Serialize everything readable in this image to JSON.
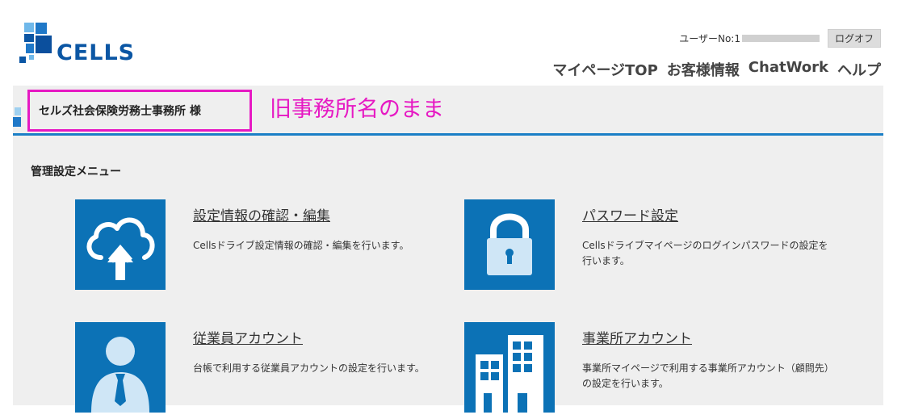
{
  "header": {
    "logo_text": "CELLS",
    "user_label": "ユーザーNo:",
    "user_no": "1",
    "logoff_label": "ログオフ",
    "nav": [
      "マイページTOP",
      "お客様情報",
      "ChatWork",
      "ヘルプ"
    ]
  },
  "title": {
    "office_name": "セルズ社会保険労務士事務所 様",
    "annotation": "旧事務所名のまま"
  },
  "menu": {
    "heading": "管理設定メニュー",
    "items": [
      {
        "title": "設定情報の確認・編集",
        "desc": "Cellsドライブ設定情報の確認・編集を行います。",
        "icon": "cloud-upload-icon"
      },
      {
        "title": "パスワード設定",
        "desc": "Cellsドライブマイページのログインパスワードの設定を行います。",
        "icon": "lock-icon"
      },
      {
        "title": "従業員アカウント",
        "desc": "台帳で利用する従業員アカウントの設定を行います。",
        "icon": "employee-icon"
      },
      {
        "title": "事業所アカウント",
        "desc": "事業所マイページで利用する事業所アカウント（顧問先）の設定を行います。",
        "icon": "building-icon"
      }
    ]
  },
  "colors": {
    "brand_blue": "#0b56a4",
    "tile_blue": "#0c72b6",
    "highlight": "#e619c3",
    "content_bg": "#efefef"
  }
}
